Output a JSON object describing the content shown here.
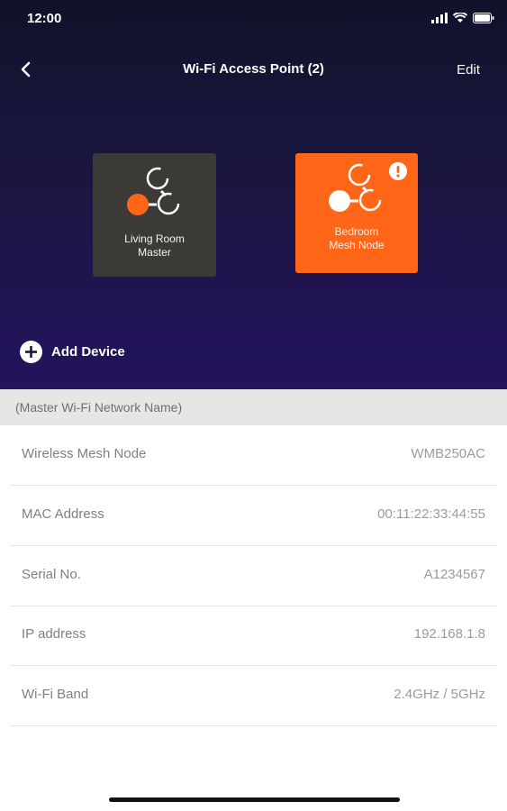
{
  "status_bar": {
    "time": "12:00"
  },
  "nav": {
    "title": "Wi-Fi Access Point (2)",
    "edit_label": "Edit"
  },
  "devices": [
    {
      "label": "Living Room\nMaster",
      "color": "#3b3a37"
    },
    {
      "label": "Bedroom\nMesh Node",
      "color": "#ff6617",
      "alert": true
    }
  ],
  "add_device": {
    "label": "Add Device"
  },
  "network": {
    "name_header": "(Master Wi-Fi Network Name)"
  },
  "details": [
    {
      "label": "Wireless Mesh Node",
      "value": "WMB250AC"
    },
    {
      "label": "MAC Address",
      "value": "00:11:22:33:44:55"
    },
    {
      "label": "Serial No.",
      "value": "A1234567"
    },
    {
      "label": "IP address",
      "value": "192.168.1.8"
    },
    {
      "label": "Wi-Fi Band",
      "value": "2.4GHz / 5GHz"
    }
  ],
  "theme": {
    "accent": "#ff6617",
    "hero_bg": "#1a1640"
  }
}
